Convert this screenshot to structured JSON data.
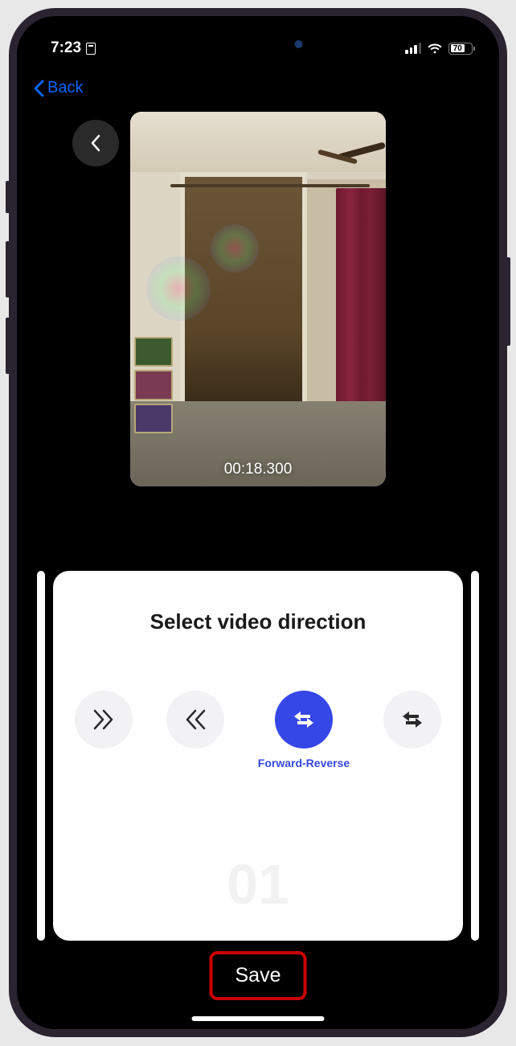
{
  "status_bar": {
    "time": "7:23",
    "battery_percent": "70"
  },
  "nav": {
    "back_label": "Back"
  },
  "video": {
    "timestamp": "00:18.300"
  },
  "panel": {
    "title": "Select video direction",
    "counter": "01",
    "options": {
      "forward": "Forward",
      "reverse": "Reverse",
      "forward_reverse": "Forward-Reverse",
      "reverse_forward": "Reverse-Forward"
    }
  },
  "actions": {
    "save": "Save"
  },
  "colors": {
    "accent": "#3647e8",
    "link": "#0a66ff",
    "highlight": "#cc0000"
  }
}
